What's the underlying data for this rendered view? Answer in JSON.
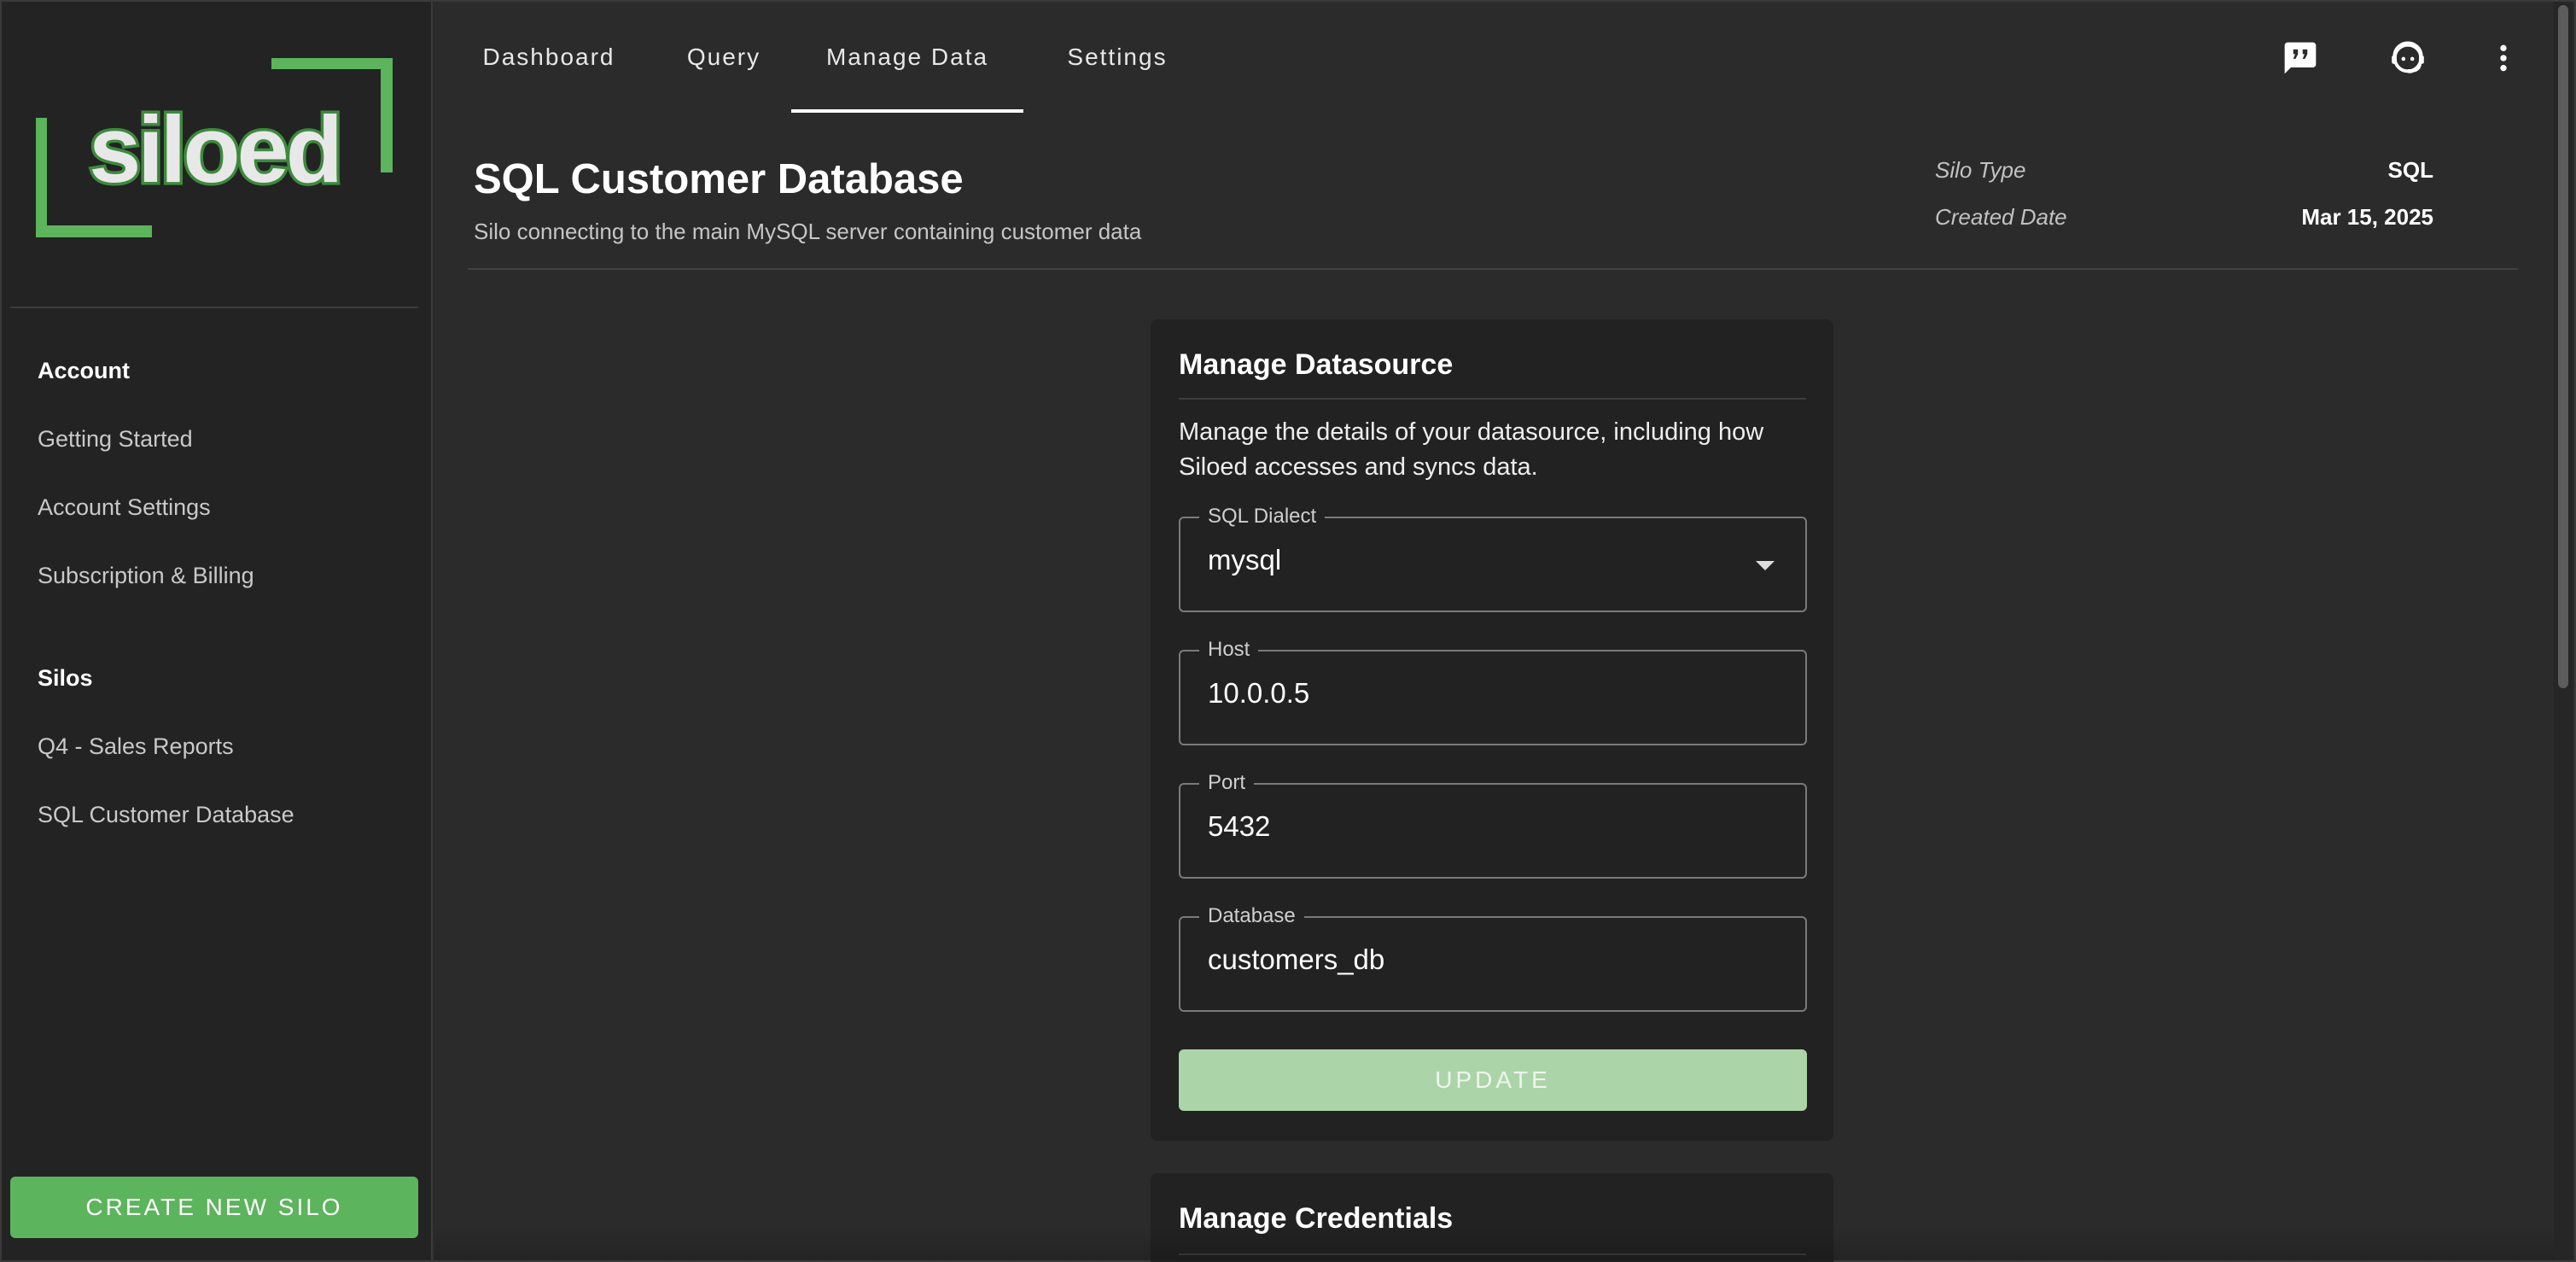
{
  "brand": {
    "logo_text": "siloed",
    "accent_color": "#5cb45c",
    "button_disabled_color": "#acd4a9"
  },
  "sidebar": {
    "account_heading": "Account",
    "account_items": [
      {
        "label": "Getting Started"
      },
      {
        "label": "Account Settings"
      },
      {
        "label": "Subscription & Billing"
      }
    ],
    "silos_heading": "Silos",
    "silo_items": [
      {
        "label": "Q4 - Sales Reports"
      },
      {
        "label": "SQL Customer Database"
      }
    ],
    "create_button_label": "CREATE NEW SILO"
  },
  "tabs": [
    {
      "label": "Dashboard",
      "active": false
    },
    {
      "label": "Query",
      "active": false
    },
    {
      "label": "Manage Data",
      "active": true
    },
    {
      "label": "Settings",
      "active": false
    }
  ],
  "top_icons": [
    "feedback-icon",
    "support-agent-icon",
    "more-vert-icon"
  ],
  "page": {
    "title": "SQL Customer Database",
    "subtitle": "Silo connecting to the main MySQL server containing customer data",
    "meta": [
      {
        "label": "Silo Type",
        "value": "SQL"
      },
      {
        "label": "Created Date",
        "value": "Mar 15, 2025"
      }
    ]
  },
  "datasource_card": {
    "title": "Manage Datasource",
    "description": "Manage the details of your datasource, including how Siloed accesses and syncs data.",
    "fields": {
      "dialect": {
        "label": "SQL Dialect",
        "value": "mysql"
      },
      "host": {
        "label": "Host",
        "value": "10.0.0.5"
      },
      "port": {
        "label": "Port",
        "value": "5432"
      },
      "database": {
        "label": "Database",
        "value": "customers_db"
      }
    },
    "update_button_label": "UPDATE"
  },
  "credentials_card": {
    "title": "Manage Credentials"
  }
}
